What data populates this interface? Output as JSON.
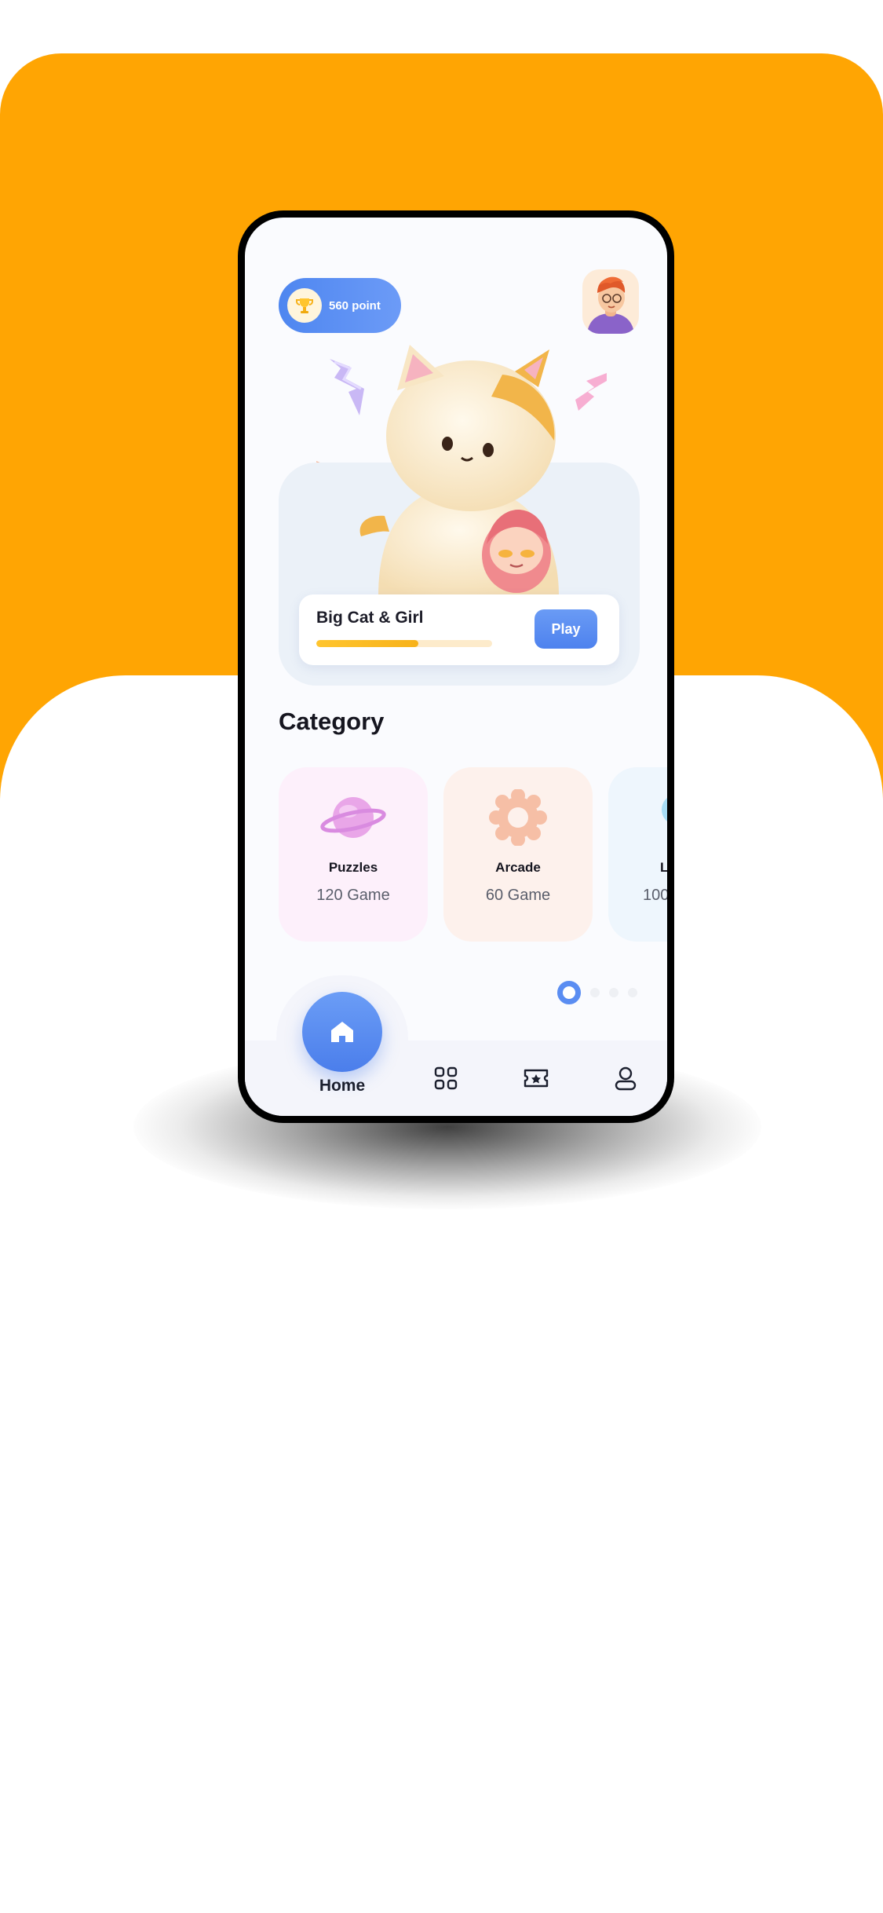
{
  "header": {
    "points_label": "560 point",
    "trophy_icon": "trophy-icon",
    "avatar": "user-avatar"
  },
  "featured": {
    "title": "Big Cat & Girl",
    "progress": 0.58,
    "play_label": "Play"
  },
  "category": {
    "title": "Category",
    "items": [
      {
        "name": "Puzzles",
        "count": "120 Game",
        "icon": "planet-icon"
      },
      {
        "name": "Arcade",
        "count": "60 Game",
        "icon": "gear-icon"
      },
      {
        "name": "L",
        "count": "100",
        "icon": "cloud-icon"
      }
    ]
  },
  "pagination": {
    "active": 0,
    "total": 4
  },
  "nav": {
    "items": [
      {
        "label": "Home",
        "icon": "home-icon"
      },
      {
        "label": "",
        "icon": "grid-icon"
      },
      {
        "label": "",
        "icon": "ticket-icon"
      },
      {
        "label": "",
        "icon": "profile-icon"
      }
    ]
  },
  "colors": {
    "background_orange": "#FFA503",
    "accent_blue": "#5A8DF2",
    "progress_yellow": "#FFC52E"
  }
}
